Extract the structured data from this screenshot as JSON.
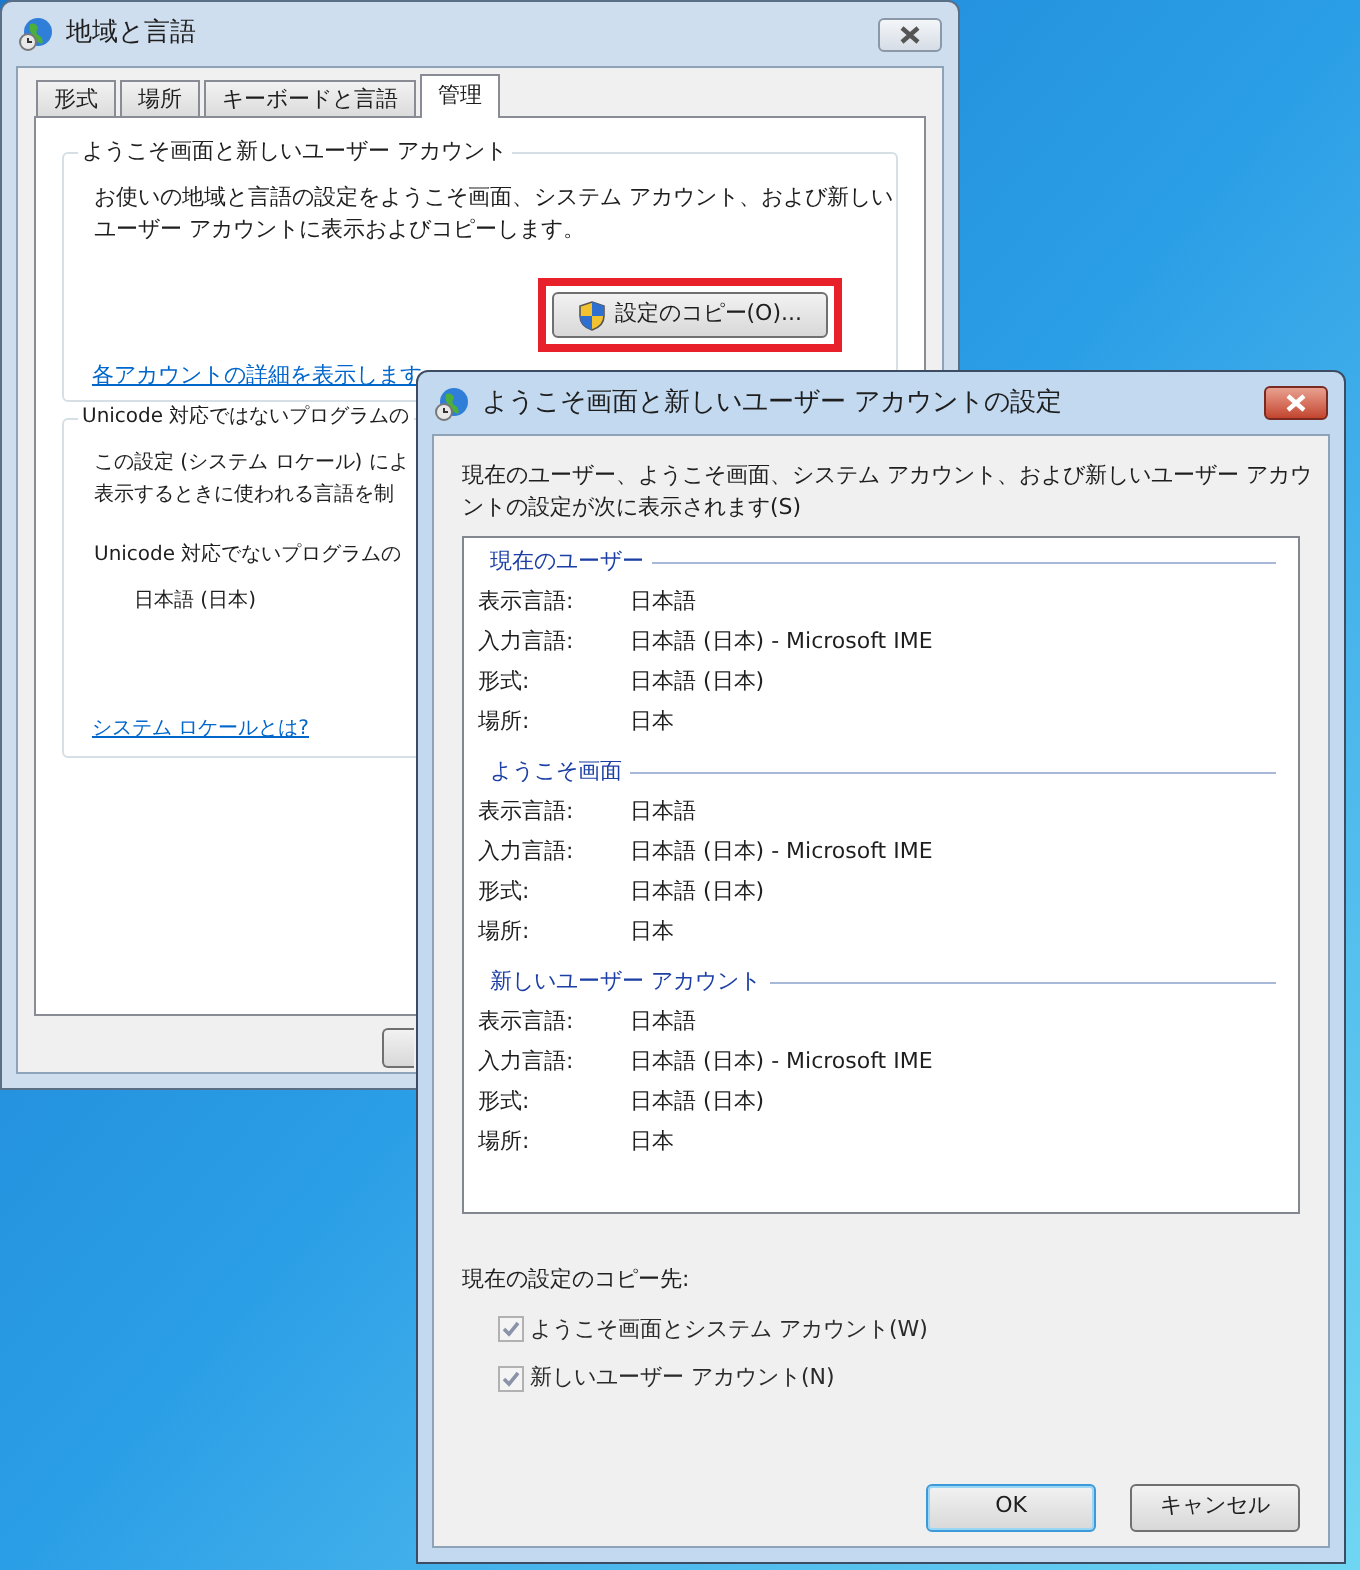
{
  "main_window": {
    "title": "地域と言語",
    "tabs": [
      {
        "label": "形式",
        "selected": false
      },
      {
        "label": "場所",
        "selected": false
      },
      {
        "label": "キーボードと言語",
        "selected": false
      },
      {
        "label": "管理",
        "selected": true
      }
    ],
    "welcome_group": {
      "title": "ようこそ画面と新しいユーザー アカウント",
      "description": "お使いの地域と言語の設定をようこそ画面、システム アカウント、および新しいユーザー アカウントに表示およびコピーします。",
      "copy_button": {
        "label": "設定のコピー(O)...",
        "highlighted": true
      },
      "link": "各アカウントの詳細を表示します"
    },
    "unicode_group": {
      "title": "Unicode 対応ではないプログラムの",
      "description_lines": [
        "この設定 (システム ロケール) によ",
        "表示するときに使われる言語を制"
      ],
      "current_label": "Unicode 対応でないプログラムの",
      "current_value": "日本語 (日本)",
      "link": "システム ロケールとは?"
    }
  },
  "dialog": {
    "title": "ようこそ画面と新しいユーザー アカウントの設定",
    "intro": "現在のユーザー、ようこそ画面、システム アカウント、および新しいユーザー アカウントの設定が次に表示されます(S)",
    "sections": [
      {
        "title": "現在のユーザー",
        "rows": [
          {
            "label": "表示言語:",
            "value": "日本語"
          },
          {
            "label": "入力言語:",
            "value": "日本語 (日本) - Microsoft IME"
          },
          {
            "label": "形式:",
            "value": "日本語 (日本)"
          },
          {
            "label": "場所:",
            "value": "日本"
          }
        ]
      },
      {
        "title": "ようこそ画面",
        "rows": [
          {
            "label": "表示言語:",
            "value": "日本語"
          },
          {
            "label": "入力言語:",
            "value": "日本語 (日本) - Microsoft IME"
          },
          {
            "label": "形式:",
            "value": "日本語 (日本)"
          },
          {
            "label": "場所:",
            "value": "日本"
          }
        ]
      },
      {
        "title": "新しいユーザー アカウント",
        "rows": [
          {
            "label": "表示言語:",
            "value": "日本語"
          },
          {
            "label": "入力言語:",
            "value": "日本語 (日本) - Microsoft IME"
          },
          {
            "label": "形式:",
            "value": "日本語 (日本)"
          },
          {
            "label": "場所:",
            "value": "日本"
          }
        ]
      }
    ],
    "copy_to_label": "現在の設定のコピー先:",
    "options": [
      {
        "label": "ようこそ画面とシステム アカウント(W)",
        "checked": true,
        "disabled": true
      },
      {
        "label": "新しいユーザー アカウント(N)",
        "checked": true,
        "disabled": true
      }
    ],
    "buttons": [
      {
        "label": "OK",
        "default": true
      },
      {
        "label": "キャンセル",
        "default": false
      }
    ]
  }
}
